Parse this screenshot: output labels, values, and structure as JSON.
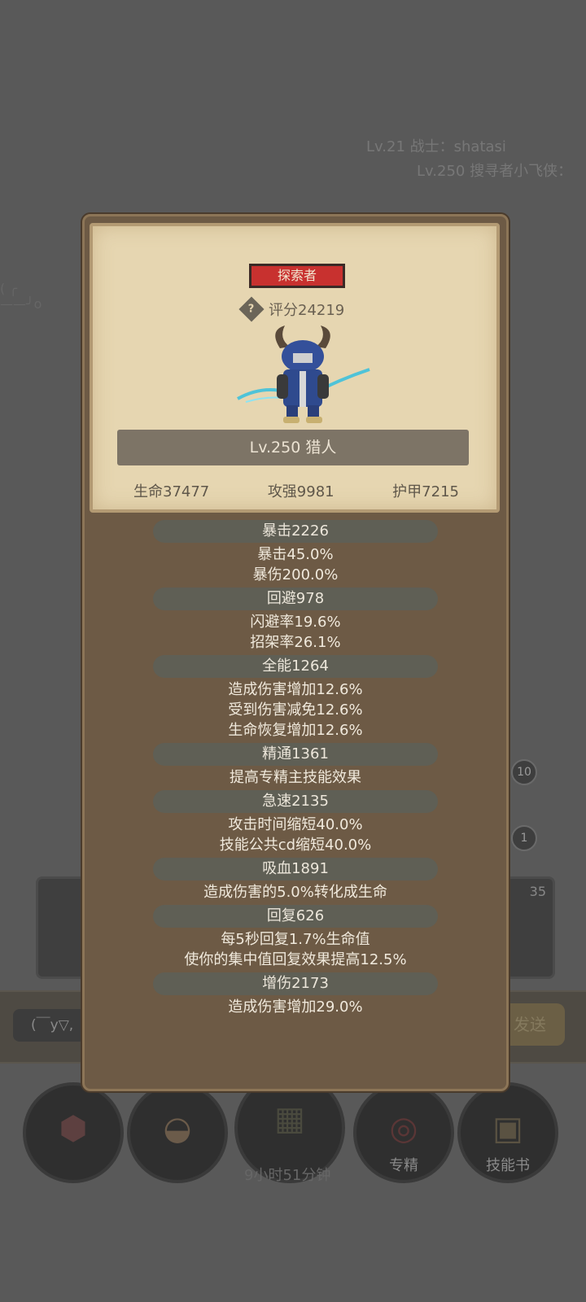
{
  "background": {
    "chat": [
      "Lv.21 战士：shatasi",
      "Lv.250 搜寻者小飞侠："
    ],
    "doodle": "( ╭\n——╯o",
    "badges": [
      "10",
      "1"
    ],
    "right_card_count": "35",
    "input_text": "(￣y▽,",
    "send_label": "发送",
    "buttons": [
      {
        "label": "",
        "icon": "potion-icon"
      },
      {
        "label": "",
        "icon": "bread-icon"
      },
      {
        "label": "",
        "icon": "chest-icon"
      },
      {
        "label": "专精",
        "icon": "target-icon"
      },
      {
        "label": "技能书",
        "icon": "book-icon"
      }
    ],
    "timer": "9小时51分钟"
  },
  "panel": {
    "class_tag": "探索者",
    "score": "评分24219",
    "name": "Lv.250 猎人",
    "core": {
      "hp": "生命37477",
      "atk": "攻强9981",
      "armor": "护甲7215"
    },
    "stats": [
      {
        "title": "暴击2226",
        "lines": [
          "暴击45.0%",
          "暴伤200.0%"
        ]
      },
      {
        "title": "回避978",
        "lines": [
          "闪避率19.6%",
          "招架率26.1%"
        ]
      },
      {
        "title": "全能1264",
        "lines": [
          "造成伤害增加12.6%",
          "受到伤害减免12.6%",
          "生命恢复增加12.6%"
        ]
      },
      {
        "title": "精通1361",
        "lines": [
          "提高专精主技能效果"
        ]
      },
      {
        "title": "急速2135",
        "lines": [
          "攻击时间缩短40.0%",
          "技能公共cd缩短40.0%"
        ]
      },
      {
        "title": "吸血1891",
        "lines": [
          "造成伤害的5.0%转化成生命"
        ]
      },
      {
        "title": "回复626",
        "lines": [
          "每5秒回复1.7%生命值",
          "使你的集中值回复效果提高12.5%"
        ]
      },
      {
        "title": "增伤2173",
        "lines": [
          "造成伤害增加29.0%"
        ]
      }
    ]
  }
}
